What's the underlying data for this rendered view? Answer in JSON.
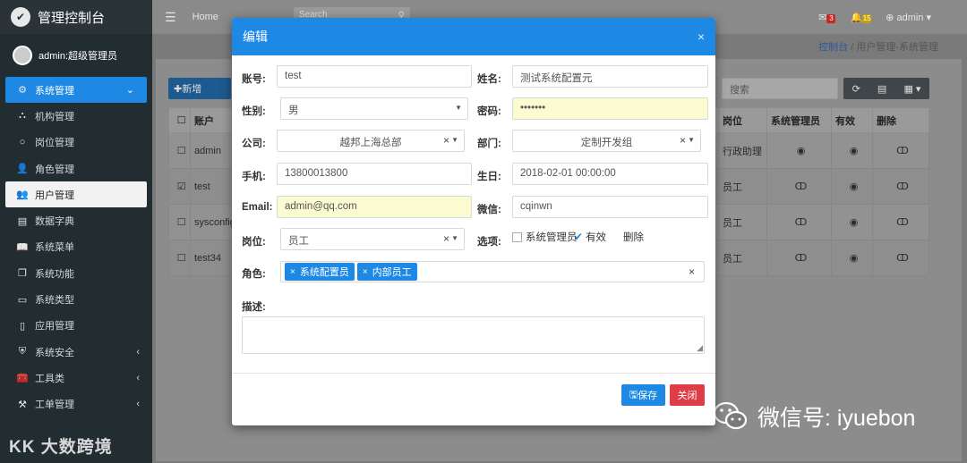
{
  "app": {
    "title": "管理控制台",
    "user": "admin:超级管理员"
  },
  "sidebar": {
    "items": [
      {
        "label": "系统管理",
        "icon": "gears-icon",
        "state": "active"
      },
      {
        "label": "机构管理",
        "icon": "sitemap-icon",
        "state": ""
      },
      {
        "label": "岗位管理",
        "icon": "circle-icon",
        "state": ""
      },
      {
        "label": "角色管理",
        "icon": "user-role-icon",
        "state": ""
      },
      {
        "label": "用户管理",
        "icon": "users-icon",
        "state": "selected"
      },
      {
        "label": "数据字典",
        "icon": "database-icon",
        "state": ""
      },
      {
        "label": "系统菜单",
        "icon": "book-icon",
        "state": ""
      },
      {
        "label": "系统功能",
        "icon": "files-icon",
        "state": ""
      },
      {
        "label": "系统类型",
        "icon": "archive-icon",
        "state": ""
      },
      {
        "label": "应用管理",
        "icon": "tablet-icon",
        "state": ""
      },
      {
        "label": "系统安全",
        "icon": "shield-icon",
        "state": ""
      },
      {
        "label": "工具类",
        "icon": "toolbox-icon",
        "state": ""
      },
      {
        "label": "工单管理",
        "icon": "gavel-icon",
        "state": ""
      }
    ],
    "bottom_brand": "大数跨境"
  },
  "topbar": {
    "home": "Home",
    "search_placeholder": "Search",
    "admin": "admin",
    "mail_count": "3",
    "bell_count": "15"
  },
  "breadcrumb": {
    "link": "控制台",
    "rest": " / 用户管理-系统管理"
  },
  "background": {
    "add_button": "✚新增",
    "search_placeholder": "搜索",
    "headers": {
      "account": "账户",
      "post": "岗位",
      "sysadmin": "系统管理员",
      "valid": "有效",
      "deleted": "删除"
    },
    "rows": [
      {
        "account": "admin",
        "post": "行政助理",
        "checked": false,
        "sysadmin": true,
        "valid": true,
        "deleted": false
      },
      {
        "account": "test",
        "post": "员工",
        "checked": true,
        "sysadmin": false,
        "valid": true,
        "deleted": false
      },
      {
        "account": "sysconfig",
        "post": "员工",
        "checked": false,
        "sysadmin": false,
        "valid": true,
        "deleted": false
      },
      {
        "account": "test34",
        "post": "员工",
        "checked": false,
        "sysadmin": false,
        "valid": true,
        "deleted": false
      }
    ]
  },
  "watermark": "微信号: iyuebon",
  "modal": {
    "title": "编辑",
    "close_glyph": "×",
    "labels": {
      "account": "账号:",
      "name": "姓名:",
      "gender": "性别:",
      "password": "密码:",
      "company": "公司:",
      "department": "部门:",
      "mobile": "手机:",
      "birthday": "生日:",
      "email": "Email:",
      "wechat": "微信:",
      "post": "岗位:",
      "options": "选项:",
      "roles": "角色:",
      "description": "描述:"
    },
    "values": {
      "account": "test",
      "name": "测试系统配置元",
      "gender": "男",
      "password": "•••••••",
      "company": "越邦上海总部",
      "department": "定制开发组",
      "mobile": "13800013800",
      "birthday": "2018-02-01 00:00:00",
      "email": "admin@qq.com",
      "wechat": "cqinwn",
      "post": "员工"
    },
    "options": {
      "sysadmin": "系统管理员",
      "valid": "有效",
      "deleted": "删除",
      "sysadmin_checked": false,
      "valid_checked": true,
      "deleted_checked": false
    },
    "roles": [
      "系统配置员",
      "内部员工"
    ],
    "save": "保存",
    "close": "关闭",
    "colors": {
      "primary": "#1e88e5",
      "danger": "#e03c48",
      "highlight": "#fbfbd2"
    }
  }
}
